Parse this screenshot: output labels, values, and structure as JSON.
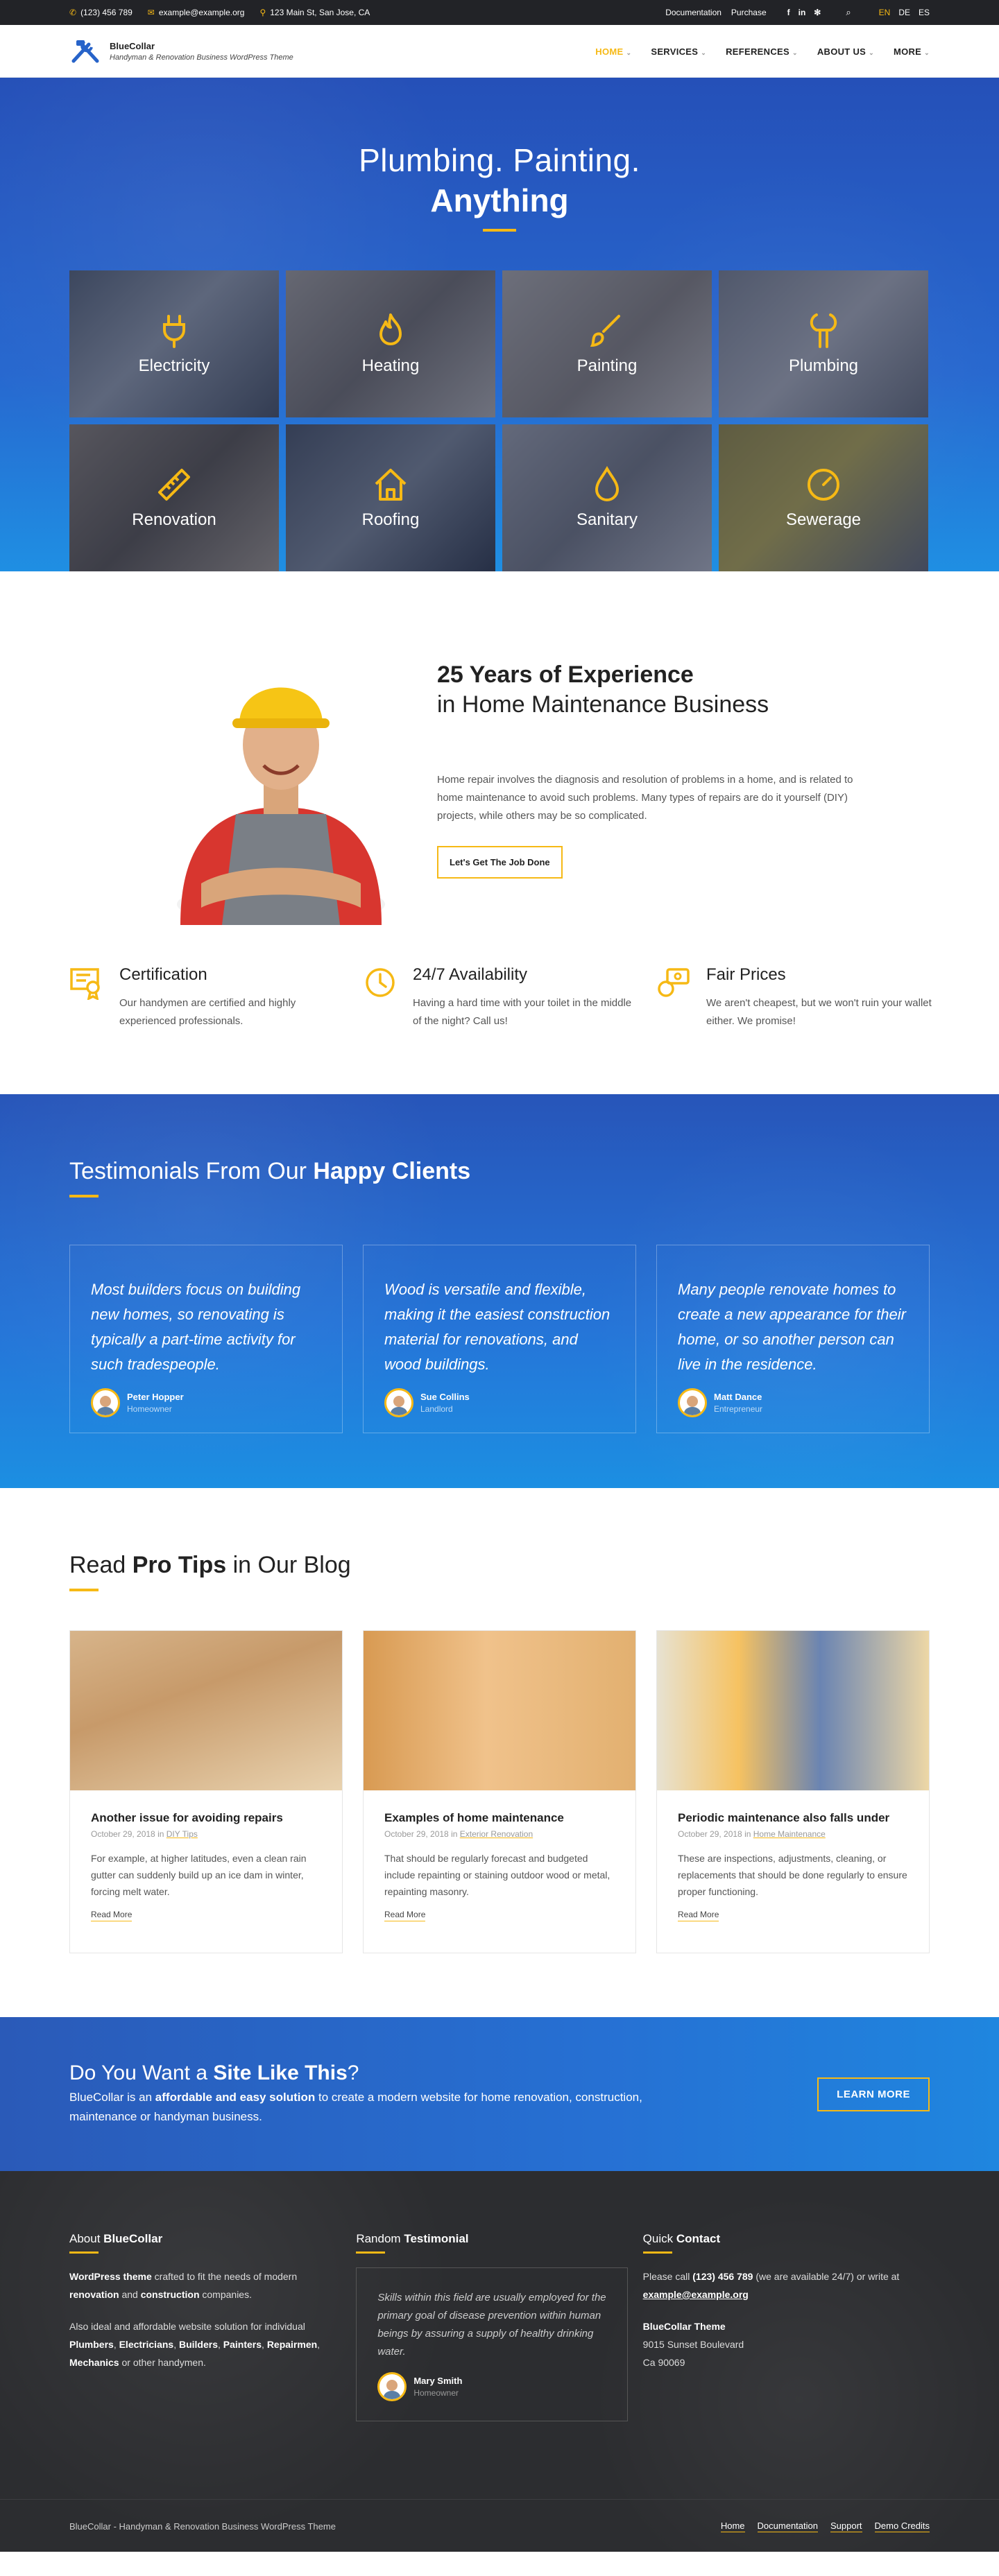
{
  "topbar": {
    "phone": "(123) 456 789",
    "email": "example@example.org",
    "address": "123 Main St, San Jose, CA",
    "links": [
      "Documentation",
      "Purchase"
    ],
    "languages": [
      "EN",
      "DE",
      "ES"
    ],
    "active_language": "EN"
  },
  "header": {
    "site_title": "BlueCollar",
    "tagline": "Handyman & Renovation Business WordPress Theme",
    "nav": [
      "HOME",
      "SERVICES",
      "REFERENCES",
      "ABOUT US",
      "MORE"
    ],
    "active_nav": "HOME"
  },
  "hero": {
    "title_line1": "Plumbing. Painting.",
    "title_line2": "Anything",
    "services": [
      {
        "label": "Electricity",
        "icon": "plug-icon"
      },
      {
        "label": "Heating",
        "icon": "flame-icon"
      },
      {
        "label": "Painting",
        "icon": "paintbrush-icon"
      },
      {
        "label": "Plumbing",
        "icon": "faucet-icon"
      },
      {
        "label": "Renovation",
        "icon": "ruler-icon"
      },
      {
        "label": "Roofing",
        "icon": "house-icon"
      },
      {
        "label": "Sanitary",
        "icon": "droplet-icon"
      },
      {
        "label": "Sewerage",
        "icon": "gauge-icon"
      }
    ]
  },
  "experience": {
    "heading_bold": "25 Years of Experience",
    "heading_rest": "in Home Maintenance Business",
    "paragraph": "Home repair involves the diagnosis and resolution of problems in a home, and is related to home maintenance to avoid such problems. Many types of repairs are do it yourself (DIY) projects, while others may be so complicated.",
    "button": "Let's Get The Job Done"
  },
  "features": [
    {
      "title": "Certification",
      "text": "Our handymen are certified and highly experienced professionals.",
      "icon": "certificate-icon"
    },
    {
      "title": "24/7 Availability",
      "text": "Having a hard time with your toilet in the middle of the night? Call us!",
      "icon": "clock-icon"
    },
    {
      "title": "Fair Prices",
      "text": "We aren't cheapest, but we won't ruin your wallet either. We promise!",
      "icon": "coins-icon"
    }
  ],
  "testimonials": {
    "heading_light": "Testimonials From Our",
    "heading_bold": "Happy Clients",
    "items": [
      {
        "quote": "Most builders focus on building new homes, so renovating is typically a part-time activity for such tradespeople.",
        "name": "Peter Hopper",
        "role": "Homeowner"
      },
      {
        "quote": "Wood is versatile and flexible, making it the easiest construction material for renovations, and wood buildings.",
        "name": "Sue Collins",
        "role": "Landlord"
      },
      {
        "quote": "Many people renovate homes to create a new appearance for their home, or so another person can live in the residence.",
        "name": "Matt Dance",
        "role": "Entrepreneur"
      }
    ]
  },
  "blog": {
    "heading_pre": "Read",
    "heading_bold": "Pro Tips",
    "heading_post": "in Our Blog",
    "posts": [
      {
        "title": "Another issue for avoiding repairs",
        "date": "October 29, 2018 in",
        "category": "DIY Tips",
        "excerpt": "For example, at higher latitudes, even a clean rain gutter can suddenly build up an ice dam in winter, forcing melt water.",
        "more": "Read More"
      },
      {
        "title": "Examples of home maintenance",
        "date": "October 29, 2018 in",
        "category": "Exterior Renovation",
        "excerpt": "That should be regularly forecast and budgeted include repainting or staining outdoor wood or metal, repainting masonry.",
        "more": "Read More"
      },
      {
        "title": "Periodic maintenance also falls under",
        "date": "October 29, 2018 in",
        "category": "Home Maintenance",
        "excerpt": "These are inspections, adjustments, cleaning, or replacements that should be done regularly to ensure proper functioning.",
        "more": "Read More"
      }
    ]
  },
  "cta": {
    "heading_pre": "Do You Want a",
    "heading_bold": "Site Like This",
    "heading_post": "?",
    "text_pre": "BlueCollar is an",
    "text_bold": "affordable and easy solution",
    "text_post": "to create a modern website for home renovation, construction, maintenance or handyman business.",
    "button": "LEARN MORE"
  },
  "footer": {
    "about_heading_pre": "About",
    "about_heading_bold": "BlueCollar",
    "about_p1_bold": "WordPress theme",
    "about_p1_a": "crafted to fit the needs of modern",
    "about_p1_b1": "renovation",
    "about_p1_and": "and",
    "about_p1_b2": "construction",
    "about_p1_end": "companies.",
    "about_p2_pre": "Also ideal and affordable website solution for individual",
    "about_p2_list": [
      "Plumbers",
      "Electricians",
      "Builders",
      "Painters",
      "Repairmen",
      "Mechanics"
    ],
    "about_p2_post": "or other handymen.",
    "testi_heading_pre": "Random",
    "testi_heading_bold": "Testimonial",
    "testi_quote": "Skills within this field are usually employed for the primary goal of disease prevention within human beings by assuring a supply of healthy drinking water.",
    "testi_name": "Mary Smith",
    "testi_role": "Homeowner",
    "contact_heading_pre": "Quick",
    "contact_heading_bold": "Contact",
    "contact_pre": "Please call",
    "contact_phone": "(123) 456 789",
    "contact_mid": "(we are available 24/7) or write at",
    "contact_email": "example@example.org",
    "contact_name": "BlueCollar Theme",
    "contact_street": "9015 Sunset Boulevard",
    "contact_city": "Ca 90069",
    "copyright": "BlueCollar - Handyman & Renovation Business WordPress Theme",
    "bottom_links": [
      "Home",
      "Documentation",
      "Support",
      "Demo Credits"
    ]
  },
  "colors": {
    "accent": "#f6b915",
    "blue": "#2763c9",
    "dark": "#2c2d30"
  }
}
